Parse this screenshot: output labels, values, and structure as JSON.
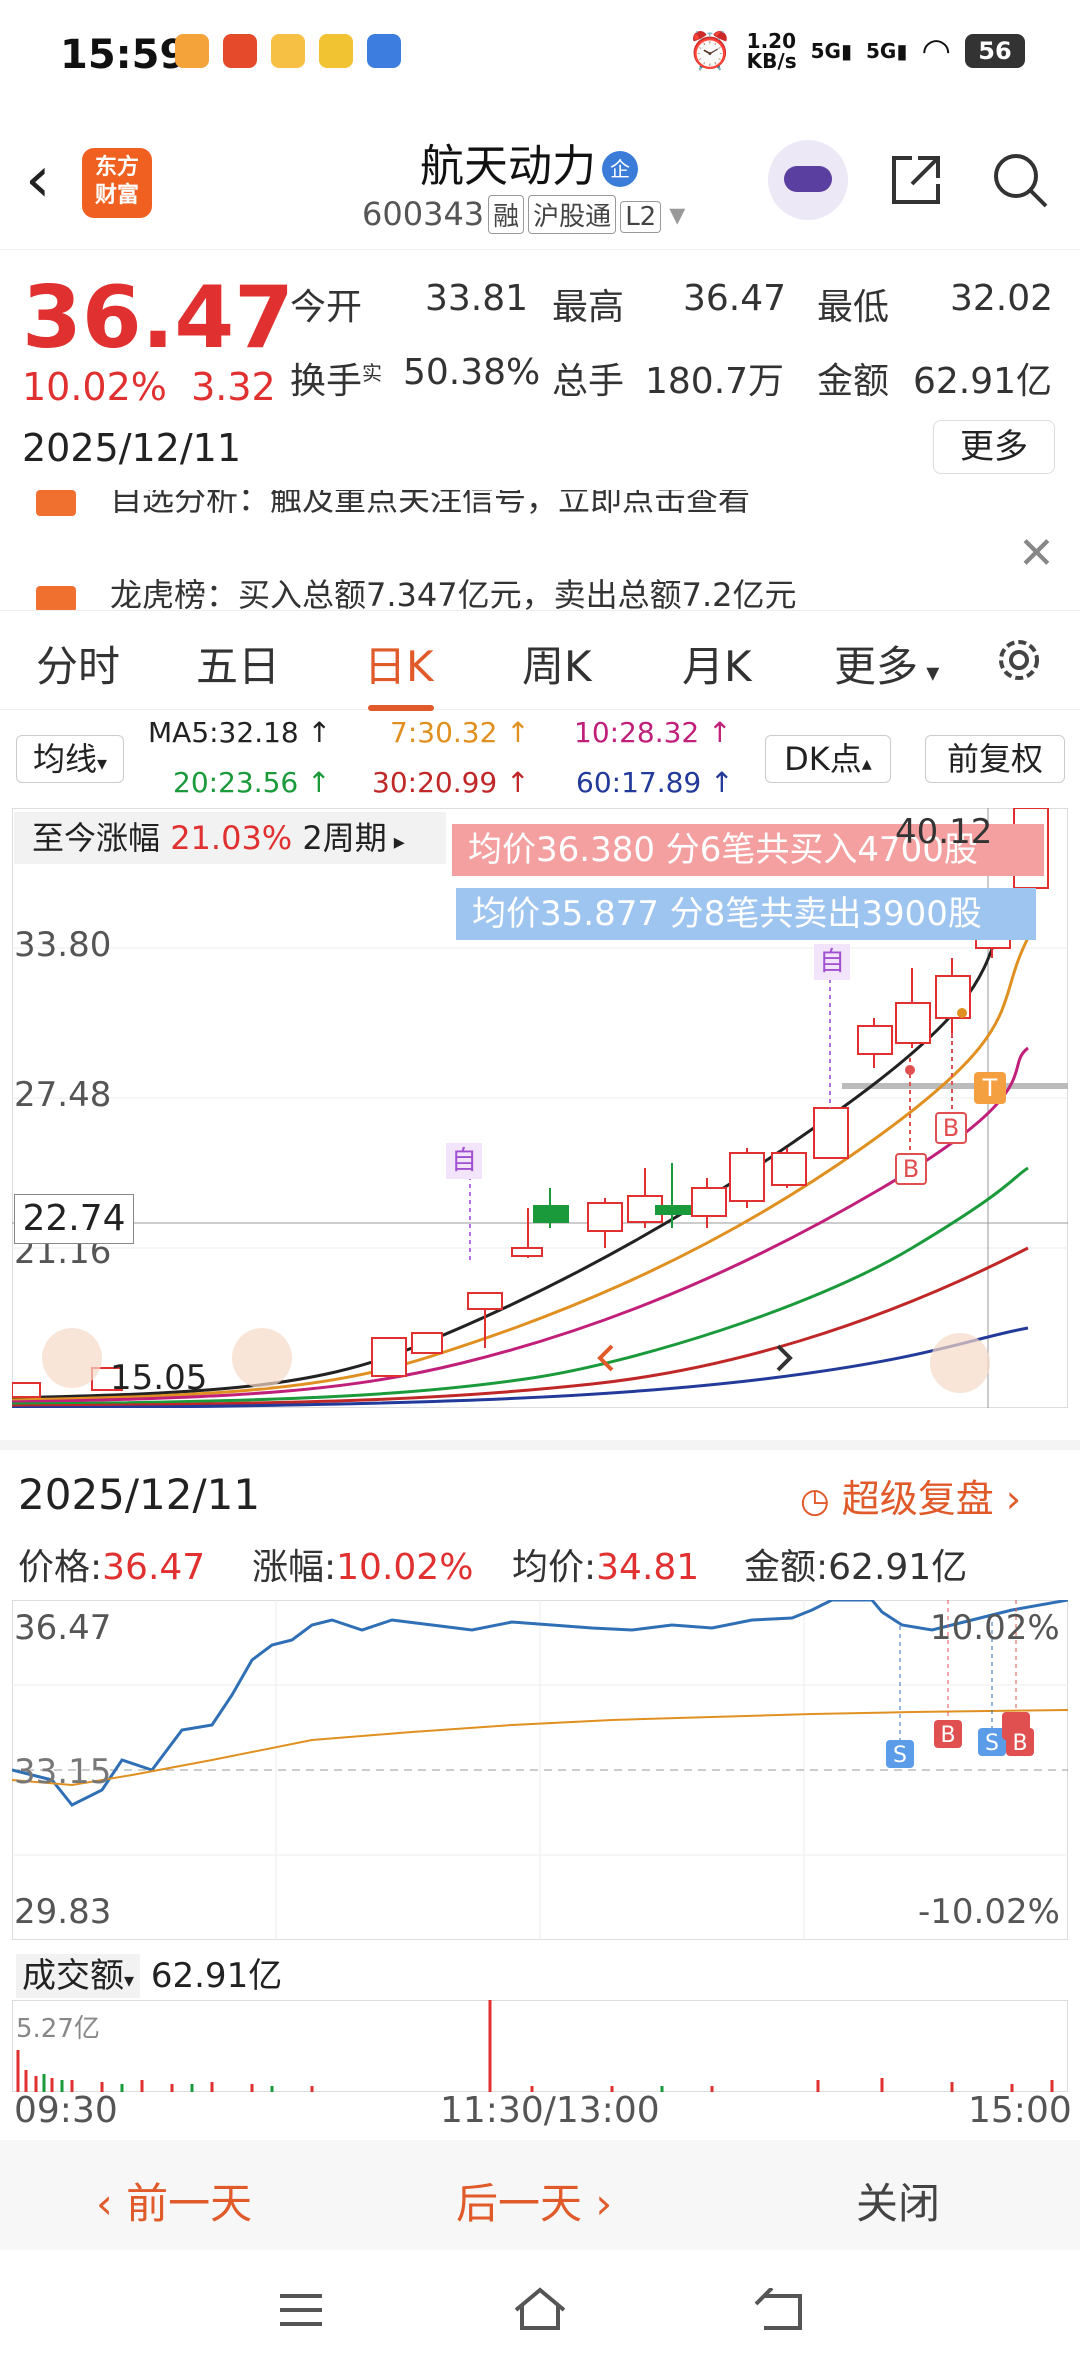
{
  "status": {
    "time": "15:59",
    "net_speed": "1.20\nKB/s",
    "signal1": "5G",
    "signal2": "5G",
    "battery": "56"
  },
  "header": {
    "logo_text": "东方\n财富",
    "stock_name": "航天动力",
    "name_badge": "企",
    "code": "600343",
    "tags": [
      "融",
      "沪股通",
      "L2"
    ]
  },
  "quote": {
    "price": "36.47",
    "change_pct": "10.02%",
    "change": "3.32",
    "date": "2025/12/11",
    "open_label": "今开",
    "open": "33.81",
    "high_label": "最高",
    "high": "36.47",
    "low_label": "最低",
    "low": "32.02",
    "turnover_label": "换手",
    "turnover_sup": "实",
    "turnover": "50.38%",
    "volume_label": "总手",
    "volume": "180.7万",
    "amount_label": "金额",
    "amount": "62.91亿",
    "more": "更多"
  },
  "notices": [
    "自选分析：触及重点关注信号，立即点击查看",
    "龙虎榜：买入总额7.347亿元，卖出总额7.2亿元"
  ],
  "tabs": [
    "分时",
    "五日",
    "日K",
    "周K",
    "月K",
    "更多"
  ],
  "active_tab": "日K",
  "ma_panel": {
    "selector": "均线",
    "ma5": "MA5:32.18 ↑",
    "ma7": "7:30.32 ↑",
    "ma10": "10:28.32 ↑",
    "ma20": "20:23.56 ↑",
    "ma30": "30:20.99 ↑",
    "ma60": "60:17.89 ↑",
    "dk": "DK点",
    "fq": "前复权"
  },
  "kline": {
    "range_label": "至今涨幅",
    "range_value": "21.03%",
    "range_period": "2周期",
    "buy_info": "均价36.380  分6笔共买入4700股",
    "sell_info": "均价35.877  分8笔共卖出3900股",
    "y_high": "40.12",
    "y1": "33.80",
    "y2": "27.48",
    "crosshair_price": "22.74",
    "y3": "21.16",
    "low_marker": "15.05",
    "marker_zi": "自",
    "marker_b": "B",
    "marker_t": "T"
  },
  "detail": {
    "date": "2025/12/11",
    "replay": "超级复盘",
    "price_label": "价格:",
    "price": "36.47",
    "change_label": "涨幅:",
    "change": "10.02%",
    "avg_label": "均价:",
    "avg": "34.81",
    "amount_label": "金额:",
    "amount": "62.91亿",
    "y_top": "36.47",
    "y_top_pct": "10.02%",
    "y_mid": "33.15",
    "y_bottom": "29.83",
    "y_bottom_pct": "-10.02%",
    "vol_selector": "成交额",
    "vol_value": "62.91亿",
    "vol_max": "5.27亿",
    "times": [
      "09:30",
      "11:30/13:00",
      "15:00"
    ]
  },
  "bottom_nav": {
    "prev": "前一天",
    "next": "后一天",
    "close": "关闭"
  },
  "colors": {
    "up": "#e03030",
    "down": "#1a9a3a",
    "accent": "#e05a2a"
  }
}
